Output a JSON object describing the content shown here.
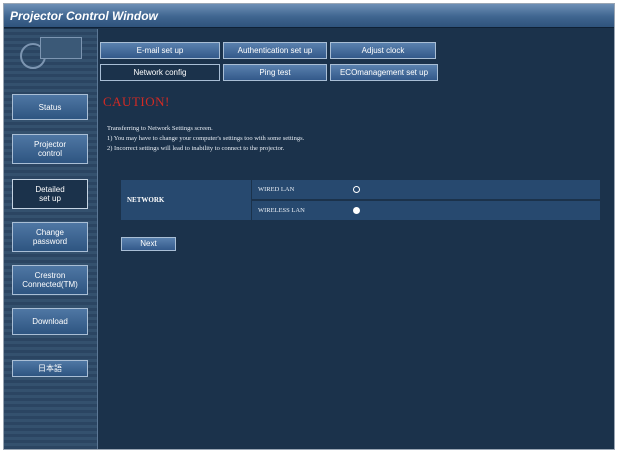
{
  "window": {
    "title": "Projector Control Window"
  },
  "sidebar": {
    "buttons": [
      {
        "label": "Status"
      },
      {
        "label": "Projector\ncontrol"
      },
      {
        "label": "Detailed\nset up"
      },
      {
        "label": "Change\npassword"
      },
      {
        "label": "Crestron\nConnected(TM)"
      },
      {
        "label": "Download"
      },
      {
        "label": "日本語"
      }
    ]
  },
  "tabs": {
    "row1": [
      "E-mail set up",
      "Authentication set up",
      "Adjust clock"
    ],
    "row2": [
      "Network config",
      "Ping test",
      "ECOmanagement set up"
    ],
    "active": "Network config"
  },
  "main": {
    "caution": "CAUTION!",
    "lines": [
      "Transferring to Network Settings screen.",
      "1)   You may have to change your computer's settings too with some settings.",
      "2)   Incorrect settings will lead to inability to connect to the projector."
    ],
    "network": {
      "heading": "NETWORK",
      "options": [
        {
          "label": "WIRED LAN",
          "selected": false
        },
        {
          "label": "WIRELESS LAN",
          "selected": true
        }
      ]
    },
    "next_label": "Next"
  },
  "colors": {
    "background": "#1b324b",
    "caution": "#d22a24",
    "button": "#3d6594"
  }
}
